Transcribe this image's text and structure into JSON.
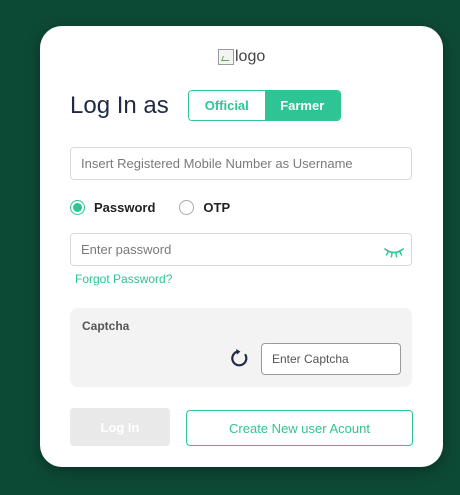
{
  "logo": {
    "alt_text": "logo",
    "icon": "broken-image-icon"
  },
  "login": {
    "title": "Log In as",
    "toggle": {
      "official_label": "Official",
      "farmer_label": "Farmer",
      "selected": "Farmer"
    },
    "username": {
      "placeholder": "Insert Registered Mobile Number as Username",
      "value": ""
    },
    "auth_method": {
      "options": [
        "Password",
        "OTP"
      ],
      "selected": "Password"
    },
    "password": {
      "placeholder": "Enter password",
      "value": "",
      "icon": "eye-closed-icon"
    },
    "forgot_label": "Forgot Password?",
    "captcha": {
      "label": "Captcha",
      "refresh_icon": "refresh-icon",
      "placeholder": "Enter Captcha",
      "value": ""
    },
    "login_button": "Log In",
    "create_button": "Create New user Acount"
  },
  "colors": {
    "background": "#0d4a36",
    "accent": "#2ec493",
    "title": "#1f2a44",
    "disabled_button": "#e9e9e9"
  }
}
